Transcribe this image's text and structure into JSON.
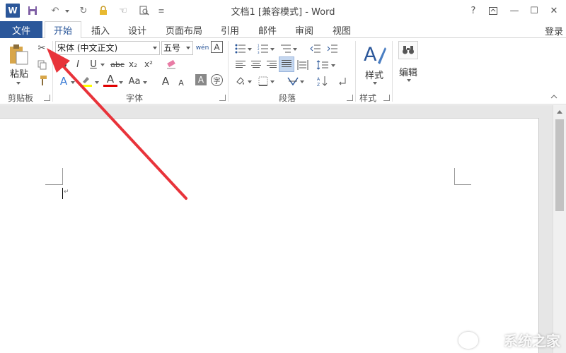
{
  "window": {
    "title": "文档1 [兼容模式] - Word",
    "help": "?",
    "signin": "登录"
  },
  "qat": {
    "word_logo": "W"
  },
  "tabs": {
    "file": "文件",
    "items": [
      "开始",
      "插入",
      "设计",
      "页面布局",
      "引用",
      "邮件",
      "审阅",
      "视图"
    ]
  },
  "ribbon": {
    "clipboard": {
      "paste_label": "粘贴",
      "group": "剪贴板"
    },
    "font": {
      "family": "宋体 (中文正文)",
      "size": "五号",
      "phonetic": "wén",
      "group": "字体",
      "bold": "B",
      "italic": "I",
      "underline": "U",
      "strike": "abc",
      "subscript": "x₂",
      "superscript": "x²",
      "case": "Aa",
      "grow": "A",
      "shrink": "A",
      "border_char": "A",
      "enclose": "字",
      "text_effect": "A",
      "font_color": "A"
    },
    "paragraph": {
      "group": "段落"
    },
    "styles": {
      "label": "样式",
      "group": "样式"
    },
    "editing": {
      "label": "编辑"
    }
  },
  "watermark": {
    "text": "系统之家"
  },
  "colors": {
    "accent": "#2b579a",
    "arrow": "#e8333a",
    "highlight": "#ffff00",
    "font_color": "#e00000"
  }
}
